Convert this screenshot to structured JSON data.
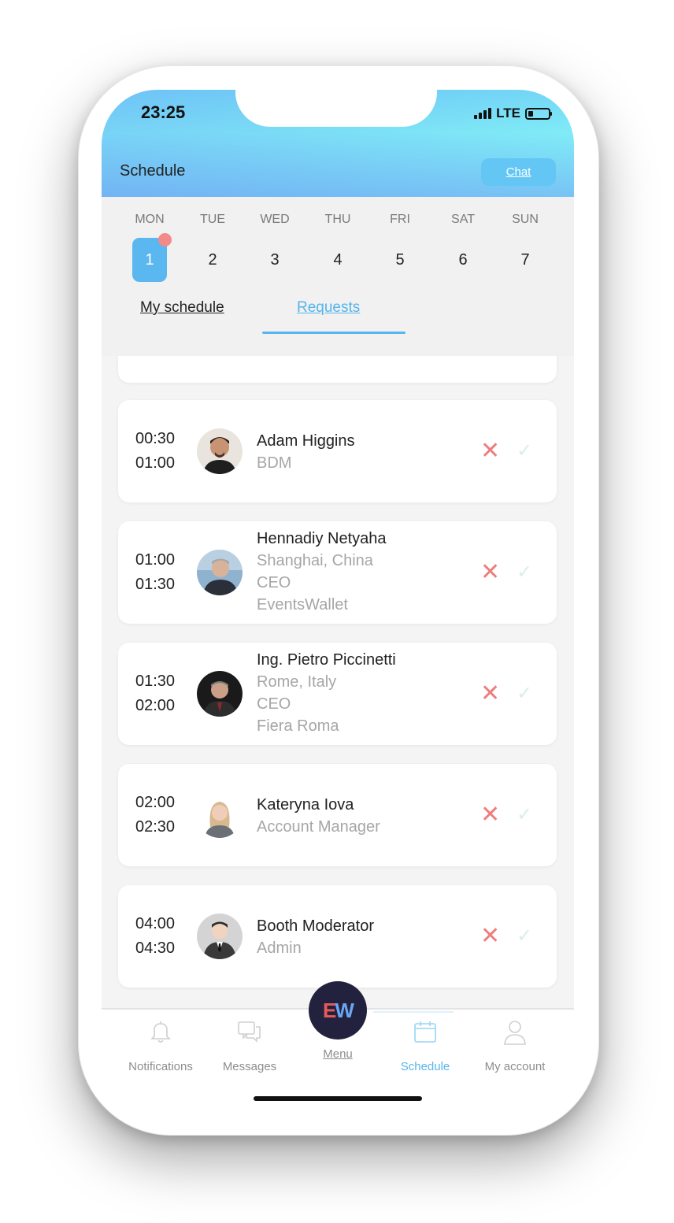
{
  "status_bar": {
    "time": "23:25",
    "network": "LTE"
  },
  "header": {
    "title": "Schedule",
    "chat_label": "Chat"
  },
  "week": [
    {
      "name": "MON",
      "num": "1",
      "active": true
    },
    {
      "name": "TUE",
      "num": "2"
    },
    {
      "name": "WED",
      "num": "3"
    },
    {
      "name": "THU",
      "num": "4"
    },
    {
      "name": "FRI",
      "num": "5"
    },
    {
      "name": "SAT",
      "num": "6"
    },
    {
      "name": "SUN",
      "num": "7"
    }
  ],
  "tabs": {
    "my_schedule": "My schedule",
    "requests": "Requests"
  },
  "meetings": [
    {
      "start": "00:30",
      "end": "01:00",
      "name": "Adam Higgins",
      "details": [
        "BDM"
      ]
    },
    {
      "start": "01:00",
      "end": "01:30",
      "name": "Hennadiy Netyaha",
      "details": [
        "Shanghai, China",
        "CEO",
        "EventsWallet"
      ]
    },
    {
      "start": "01:30",
      "end": "02:00",
      "name": "Ing. Pietro Piccinetti",
      "details": [
        "Rome, Italy",
        "CEO",
        "Fiera Roma"
      ]
    },
    {
      "start": "02:00",
      "end": "02:30",
      "name": "Kateryna Iova",
      "details": [
        "Account Manager"
      ]
    },
    {
      "start": "04:00",
      "end": "04:30",
      "name": "Booth Moderator",
      "details": [
        "Admin"
      ]
    }
  ],
  "actions": {
    "decline_icon": "x-icon",
    "accept_icon": "check-icon"
  },
  "bottom_nav": {
    "notifications": "Notifications",
    "messages": "Messages",
    "menu": "Menu",
    "schedule": "Schedule",
    "my_account": "My account",
    "logo": {
      "e": "E",
      "w": "W"
    }
  },
  "colors": {
    "accent": "#58b6ec",
    "decline": "#ee7d7d",
    "logo_bg": "#22223e"
  }
}
